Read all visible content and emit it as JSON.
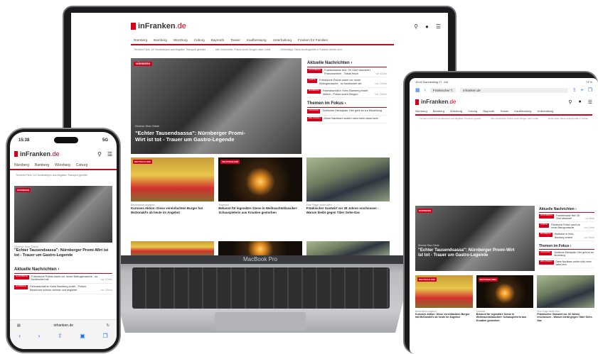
{
  "brand": {
    "prefix": "in",
    "name": "Franken",
    "tld": ".de",
    "accent": "#d6001c"
  },
  "laptop": {
    "label": "MacBook Pro"
  },
  "nav": [
    "Nürnberg",
    "Bamberg",
    "Würzburg",
    "Coburg",
    "Bayreuth",
    "Teaser",
    "Kaufberatung",
    "Unterhaltung",
    "Franken für Familien"
  ],
  "tablet_nav": [
    "Nürnberg",
    "Bamberg",
    "Würzburg",
    "Coburg",
    "Bayreuth",
    "Teaser",
    "Kaufberatung",
    "Unterhaltung"
  ],
  "phone_nav": [
    "Nürnberg",
    "Bamberg",
    "Würzburg",
    "Coburg"
  ],
  "ticker": [
    "Tierheim Fürth: 14 Hundewelpen aus illegalem Transport gerettet",
    "Alte Geschichte: Polizei sucht Zeugen nach Unfall",
    "Geheimtipp: Diese Ausflugsziele in Franken lohnen sich"
  ],
  "hero": {
    "badge": "NÜRNBERG",
    "kicker": "Diverse Star-Gäste",
    "title": "\"Echter Tausendsassa\": Nürnberger Promi-Wirt ist tot - Trauer um Gastro-Legende"
  },
  "aktuelle": {
    "title": "Aktuelle Nachrichten",
    "items": [
      {
        "tag": "NÜRNBERG",
        "text": "Frankenkasse fest: Ob Chef absolviert Franzosenbier - Tabak frisch",
        "time": "vor 8 Min"
      },
      {
        "tag": "FÜRTH",
        "text": "Fränkische Polizei warnt vor neuer Betrugsmasche - so funktioniert sie",
        "time": "vor 12min"
      },
      {
        "tag": "BAMBERG",
        "text": "Fahrradunfall in Kreis Bamberg endet tödlich - Polizei sucht Zeugen",
        "time": "vor 20min"
      }
    ]
  },
  "fokus": {
    "title": "Themen im Fokus",
    "items": [
      {
        "tag": "FRANKEN",
        "text": "Schlimme Dienstplan: Hier geht es zur Bezahlung",
        "time": ""
      },
      {
        "tag": "ERLANGEN",
        "text": "Diese Nachbarn wollen nicht mehr dabei sein",
        "time": ""
      }
    ]
  },
  "cards": [
    {
      "badge": "DEUTSCHLAND",
      "kicker": "Besonderes Angebot",
      "title": "Kurioses Aktion: Diese vereinfachten Burger hat McDonald's ab heute im Angebot"
    },
    {
      "badge": "DEUTSCHLAND",
      "kicker": "Todesfall",
      "title": "Bekannt für legendäre Szene in Weihnachtsklassiker: Schauspielerin aus Kroatien gestorben"
    },
    {
      "badge": "",
      "kicker": "Eine Frage bleibt offen",
      "title": "Fränkischer Gastwirt vor 28 Jahren erschossen - Warum bleibt gegen Täter Gehe-Dac"
    }
  ],
  "phone": {
    "time": "15:38",
    "signal": "5G",
    "url": "infranken.de",
    "aktuelle_items": [
      {
        "tag": "NÜRNBERG",
        "text": "Fränkische Polizei warnt vor neuer Betrugsmasche - so funktioniert sie",
        "time": "vor 12min"
      },
      {
        "tag": "BAMBERG",
        "text": "Fahrradunfall im Kreis Bamberg endet - Polizei: Bewohner schwer verletzt und begleitet",
        "time": "vor 20min"
      }
    ]
  },
  "tablet": {
    "status_time": "15:42",
    "status_date": "Donnerstag 17. Juli",
    "battery": "74 %",
    "tab_label": "Fränkischer T.",
    "url": "infranken.de",
    "aktuelle_items": [
      {
        "tag": "NÜRNBERG",
        "text": "Frankenkasse fest: Ob Chef absolviert",
        "time": "vor 8min"
      },
      {
        "tag": "FÜRTH",
        "text": "Fränkische Polizei warnt vor neuer Betrugsmasche",
        "time": "vor 12min"
      },
      {
        "tag": "BAMBERG",
        "text": "Radfahrer in Kreis Bamberg verletzt",
        "time": "vor 20min"
      }
    ],
    "fokus_items": [
      {
        "tag": "FRANKEN",
        "text": "Schlimme Dienstplan: Hier geht es zur Bezahlung",
        "time": ""
      },
      {
        "tag": "ERLANGEN",
        "text": "Diese Nachbarn wollen nicht mehr dabei sein",
        "time": ""
      }
    ]
  }
}
